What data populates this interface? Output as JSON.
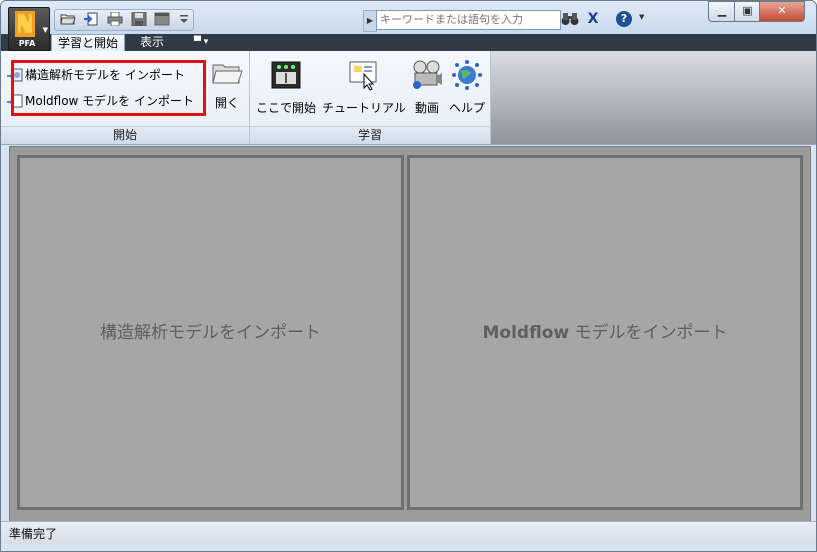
{
  "app": {
    "badge": "PFA"
  },
  "search": {
    "placeholder": "キーワードまたは語句を入力"
  },
  "tabs": [
    {
      "label": "学習と開始",
      "active": true
    },
    {
      "label": "表示",
      "active": false
    }
  ],
  "ribbon": {
    "groups": {
      "start": {
        "label": "開始",
        "commands": {
          "import_structural": "構造解析モデルを インポート",
          "import_moldflow": "Moldflow モデルを インポート",
          "open": "開く"
        }
      },
      "learn": {
        "label": "学習",
        "commands": {
          "start_here": "ここで開始",
          "tutorial": "チュートリアル",
          "video": "動画",
          "help": "ヘルプ"
        }
      }
    }
  },
  "workspace": {
    "left_panel": "構造解析モデルをインポート",
    "right_panel_bold": "Moldflow",
    "right_panel_rest": " モデルをインポート"
  },
  "statusbar": {
    "text": "準備完了"
  },
  "colors": {
    "highlight": "#e21010",
    "tab_bar": "#2f3a44",
    "workspace_bg": "#9b9b9b"
  }
}
